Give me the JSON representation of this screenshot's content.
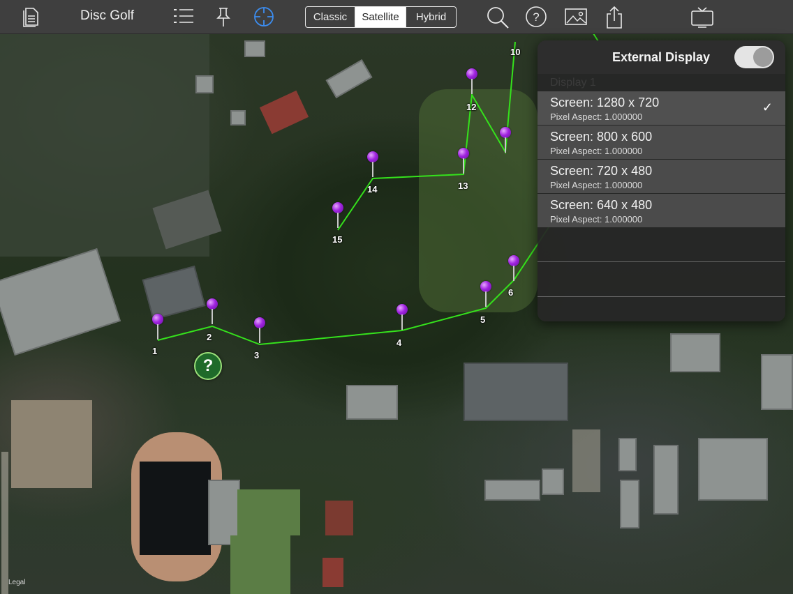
{
  "toolbar": {
    "title": "Disc Golf",
    "icons": [
      "document-icon",
      "checklist-icon",
      "pushpin-icon",
      "crosshair-icon",
      "search-icon",
      "help-icon",
      "photo-icon",
      "share-icon",
      "tv-icon"
    ],
    "map_types": [
      {
        "label": "Classic",
        "selected": false
      },
      {
        "label": "Satellite",
        "selected": true
      },
      {
        "label": "Hybrid",
        "selected": false
      }
    ],
    "accent": "#3c8df0"
  },
  "map": {
    "holes": [
      "1",
      "2",
      "3",
      "4",
      "5",
      "6",
      "10",
      "12",
      "13",
      "14",
      "15"
    ],
    "route_color": "#35e21c",
    "pin_color": "#a024e0",
    "legal": "Legal"
  },
  "external_display": {
    "title": "External Display",
    "enabled": true,
    "section": "Display 1",
    "modes": [
      {
        "screen": "Screen: 1280 x 720",
        "aspect": "Pixel Aspect: 1.000000",
        "selected": true
      },
      {
        "screen": "Screen: 800 x 600",
        "aspect": "Pixel Aspect: 1.000000",
        "selected": false
      },
      {
        "screen": "Screen: 720 x 480",
        "aspect": "Pixel Aspect: 1.000000",
        "selected": false
      },
      {
        "screen": "Screen: 640 x 480",
        "aspect": "Pixel Aspect: 1.000000",
        "selected": false
      }
    ],
    "checkmark": "✓"
  }
}
